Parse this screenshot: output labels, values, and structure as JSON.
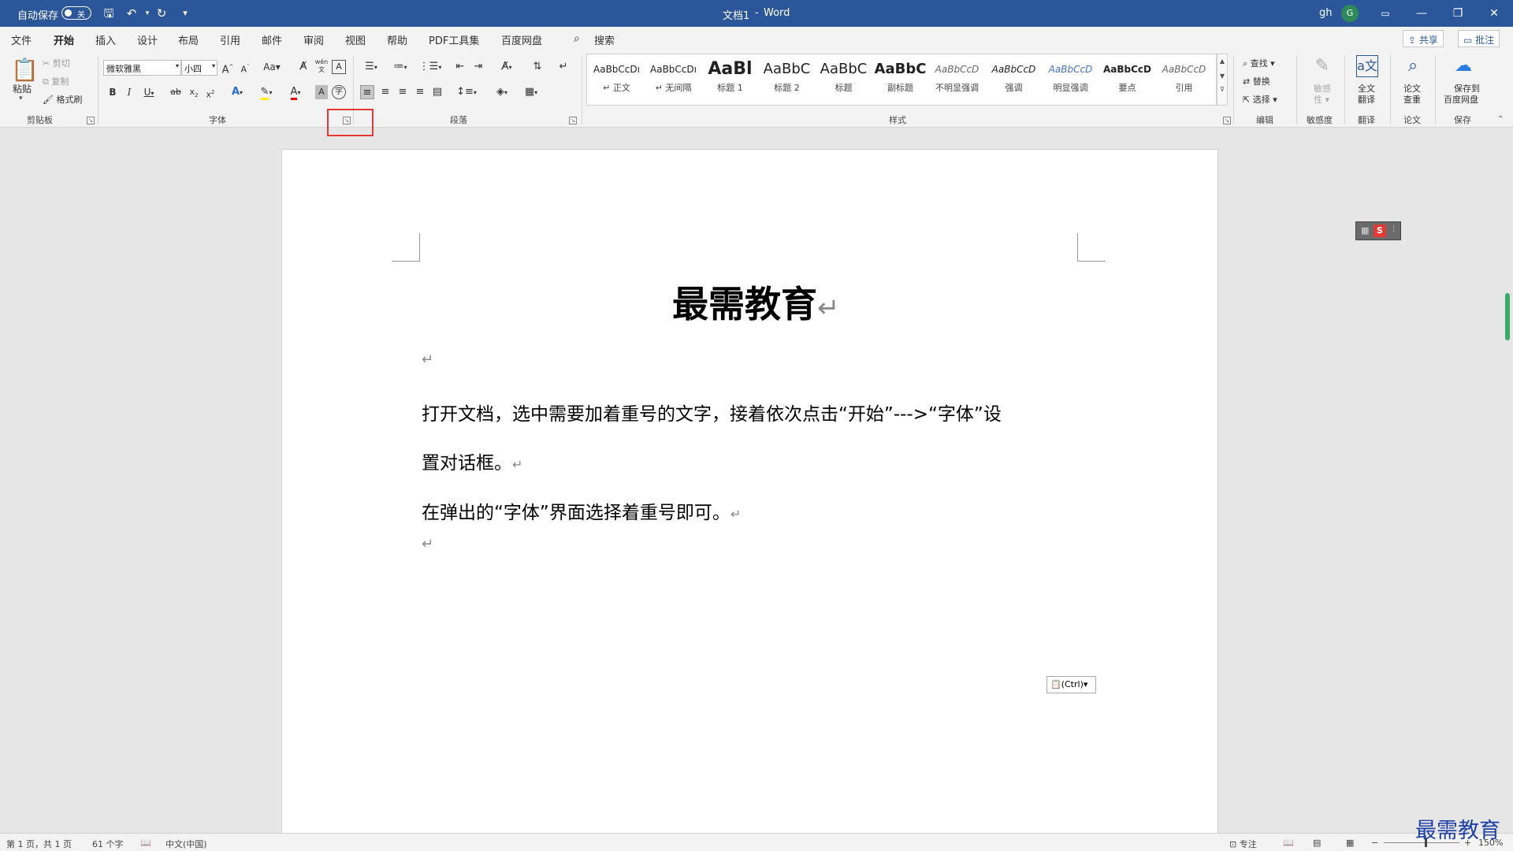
{
  "titlebar": {
    "autosave_label": "自动保存",
    "autosave_state": "关",
    "doc_title": "文档1",
    "separator": "-",
    "app_name": "Word",
    "user_name": "gh",
    "avatar_initial": "G"
  },
  "tabs": [
    "文件",
    "开始",
    "插入",
    "设计",
    "布局",
    "引用",
    "邮件",
    "审阅",
    "视图",
    "帮助",
    "PDF工具集",
    "百度网盘"
  ],
  "active_tab": "开始",
  "search_label": "搜索",
  "share_label": "共享",
  "comments_label": "批注",
  "clipboard": {
    "paste": "粘贴",
    "cut": "剪切",
    "copy": "复制",
    "format_painter": "格式刷",
    "group": "剪贴板"
  },
  "font": {
    "family": "微软雅黑",
    "size": "小四",
    "group": "字体",
    "change_case": "Aa",
    "phonetic": "wén"
  },
  "paragraph": {
    "group": "段落"
  },
  "styles": {
    "group": "样式",
    "items": [
      {
        "sample": "AaBbCcDı",
        "name": "↵ 正文"
      },
      {
        "sample": "AaBbCcDı",
        "name": "↵ 无间隔"
      },
      {
        "sample": "AaBl",
        "name": "标题 1"
      },
      {
        "sample": "AaBbC",
        "name": "标题 2"
      },
      {
        "sample": "AaBbC",
        "name": "标题"
      },
      {
        "sample": "AaBbC",
        "name": "副标题"
      },
      {
        "sample": "AaBbCcD",
        "name": "不明显强调"
      },
      {
        "sample": "AaBbCcD",
        "name": "强调"
      },
      {
        "sample": "AaBbCcD",
        "name": "明显强调"
      },
      {
        "sample": "AaBbCcD",
        "name": "要点"
      },
      {
        "sample": "AaBbCcD",
        "name": "引用"
      }
    ]
  },
  "editing": {
    "find": "查找",
    "replace": "替换",
    "select": "选择",
    "group": "编辑"
  },
  "sensitivity": {
    "label1": "敏感",
    "label2": "性",
    "group": "敏感度"
  },
  "translate": {
    "label1": "全文",
    "label2": "翻译",
    "group": "翻译"
  },
  "paper": {
    "label1": "论文",
    "label2": "查重",
    "group": "论文"
  },
  "save": {
    "label1": "保存到",
    "label2": "百度网盘",
    "group": "保存"
  },
  "document": {
    "title": "最需教育",
    "para1_line1": "打开文档，选中需要加着重号的文字，接着依次点击“开始”--->“字体”设",
    "para1_line2": "置对话框。",
    "para2": "在弹出的“字体”界面选择着重号即可。",
    "paste_ctrl": "(Ctrl)",
    "para_mark": "↵"
  },
  "statusbar": {
    "page": "第 1 页，共 1 页",
    "words": "61 个字",
    "language": "中文(中国)",
    "focus": "专注",
    "zoom": "150%"
  },
  "watermark": "最需教育",
  "colors": {
    "brand": "#2b579a",
    "highlight": "#e53935"
  }
}
